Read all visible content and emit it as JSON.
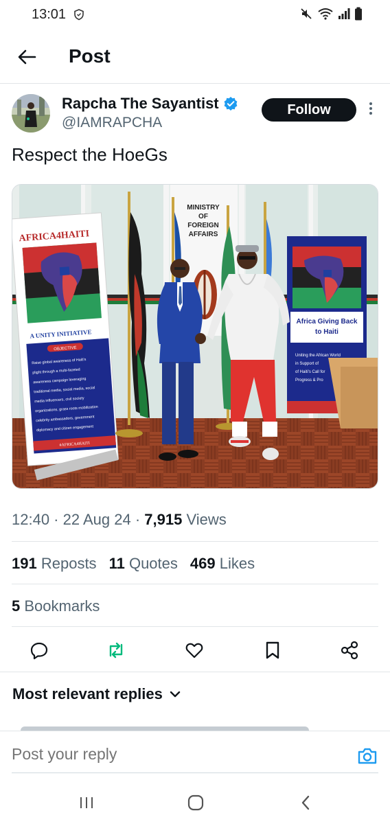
{
  "status_bar": {
    "time": "13:01",
    "icons": [
      "sync-icon",
      "mute-icon",
      "wifi-icon",
      "signal-icon",
      "battery-icon"
    ]
  },
  "header": {
    "title": "Post"
  },
  "author": {
    "name": "Rapcha The Sayantist",
    "handle": "@IAMRAPCHA",
    "follow_label": "Follow",
    "verified_color": "#1d9bf0"
  },
  "tweet": {
    "text": "Respect the HoeGs",
    "media": {
      "sign_ministry": [
        "MINISTRY",
        "OF",
        "FOREIGN",
        "AFFAIRS"
      ],
      "banner_left_title": "AFRICA4HAITI",
      "banner_left_subtitle": "A UNITY INITIATIVE",
      "banner_left_objective": "OBJECTIVE",
      "banner_left_body": [
        "Raise global awareness of Haiti's",
        "plight through a multi-faceted",
        "awareness campaign leveraging",
        "traditional media, social media, social",
        "media influencers, civil society",
        "organizations, grass roots mobilization",
        "celebrity ambassadors, government",
        "diplomacy and citizen engagement"
      ],
      "banner_left_footer": "#AFRICA4HAITI",
      "banner_right_title": [
        "Africa Giving Back",
        "to Haiti"
      ],
      "banner_right_body": [
        "Uniting the African World",
        "in Support of",
        "of Haiti's Call for",
        "Progress & Pro"
      ]
    }
  },
  "meta": {
    "time": "12:40",
    "date": "22 Aug 24",
    "views_count": "7,915",
    "views_label": "Views"
  },
  "stats": {
    "reposts_count": "191",
    "reposts_label": "Reposts",
    "quotes_count": "11",
    "quotes_label": "Quotes",
    "likes_count": "469",
    "likes_label": "Likes",
    "bookmarks_count": "5",
    "bookmarks_label": "Bookmarks"
  },
  "colors": {
    "text": "#0f1419",
    "muted": "#536471",
    "accent": "#1d9bf0",
    "repost_green": "#00ba7c"
  },
  "replies": {
    "sort_label": "Most relevant replies"
  },
  "reply_bar": {
    "placeholder": "Post your reply"
  }
}
